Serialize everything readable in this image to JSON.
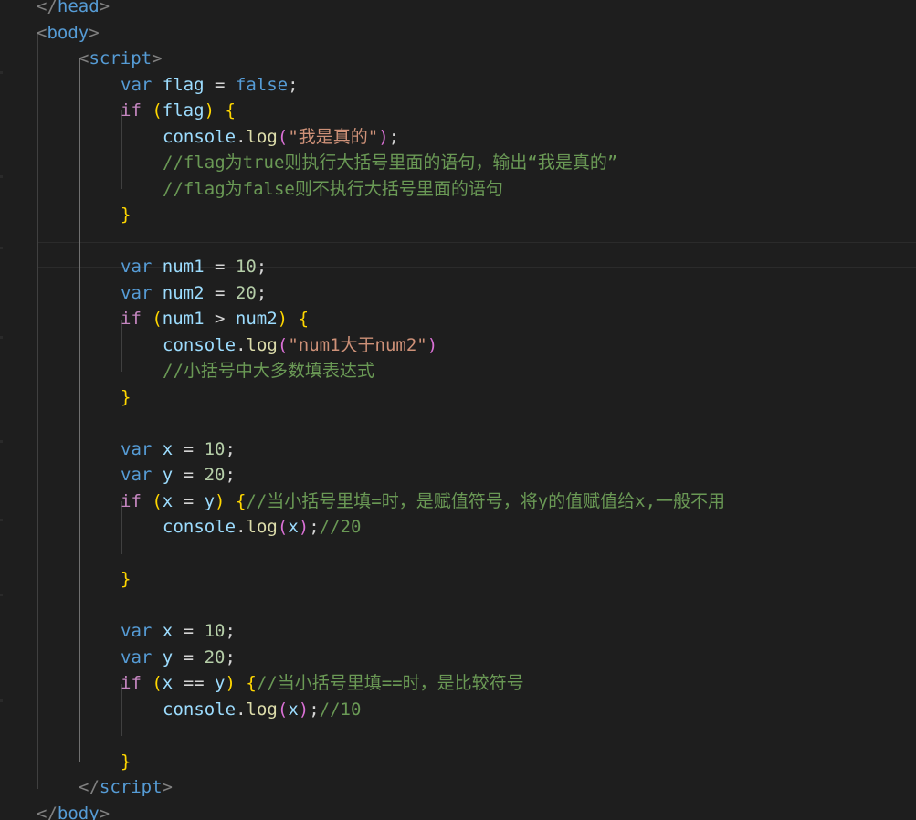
{
  "editor": {
    "theme": {
      "background": "#1e1e1e",
      "tag": "#569cd6",
      "keyword": "#569cd6",
      "control": "#c586c0",
      "identifier": "#9cdcfe",
      "function": "#dcdcaa",
      "number": "#b5cea8",
      "string": "#ce9178",
      "comment": "#6a9955",
      "bracket_level1": "#ffd700",
      "bracket_level2": "#da70d6"
    },
    "lines": [
      {
        "indent": 0,
        "tokens": [
          [
            "punct",
            "</"
          ],
          [
            "tag",
            "head"
          ],
          [
            "punct",
            ">"
          ]
        ]
      },
      {
        "indent": 0,
        "tokens": [
          [
            "punct",
            "<"
          ],
          [
            "tag",
            "body"
          ],
          [
            "punct",
            ">"
          ]
        ]
      },
      {
        "indent": 1,
        "tokens": [
          [
            "punct",
            "<"
          ],
          [
            "tag",
            "script"
          ],
          [
            "punct",
            ">"
          ]
        ]
      },
      {
        "indent": 2,
        "tokens": [
          [
            "kw",
            "var"
          ],
          [
            "op",
            " "
          ],
          [
            "id",
            "flag"
          ],
          [
            "op",
            " = "
          ],
          [
            "kw",
            "false"
          ],
          [
            "op",
            ";"
          ]
        ]
      },
      {
        "indent": 2,
        "tokens": [
          [
            "ctl",
            "if"
          ],
          [
            "op",
            " "
          ],
          [
            "b1",
            "("
          ],
          [
            "id",
            "flag"
          ],
          [
            "b1",
            ")"
          ],
          [
            "op",
            " "
          ],
          [
            "b1",
            "{"
          ]
        ]
      },
      {
        "indent": 3,
        "tokens": [
          [
            "id",
            "console"
          ],
          [
            "op",
            "."
          ],
          [
            "fn",
            "log"
          ],
          [
            "b2",
            "("
          ],
          [
            "str",
            "\"我是真的\""
          ],
          [
            "b2",
            ")"
          ],
          [
            "op",
            ";"
          ]
        ]
      },
      {
        "indent": 3,
        "tokens": [
          [
            "cmt",
            "//flag为true则执行大括号里面的语句，输出“我是真的”"
          ]
        ]
      },
      {
        "indent": 3,
        "tokens": [
          [
            "cmt",
            "//flag为false则不执行大括号里面的语句"
          ]
        ]
      },
      {
        "indent": 2,
        "tokens": [
          [
            "b1",
            "}"
          ]
        ]
      },
      {
        "indent": 2,
        "tokens": []
      },
      {
        "indent": 2,
        "tokens": [
          [
            "kw",
            "var"
          ],
          [
            "op",
            " "
          ],
          [
            "id",
            "num1"
          ],
          [
            "op",
            " = "
          ],
          [
            "num",
            "10"
          ],
          [
            "op",
            ";"
          ]
        ]
      },
      {
        "indent": 2,
        "tokens": [
          [
            "kw",
            "var"
          ],
          [
            "op",
            " "
          ],
          [
            "id",
            "num2"
          ],
          [
            "op",
            " = "
          ],
          [
            "num",
            "20"
          ],
          [
            "op",
            ";"
          ]
        ]
      },
      {
        "indent": 2,
        "tokens": [
          [
            "ctl",
            "if"
          ],
          [
            "op",
            " "
          ],
          [
            "b1",
            "("
          ],
          [
            "id",
            "num1"
          ],
          [
            "op",
            " > "
          ],
          [
            "id",
            "num2"
          ],
          [
            "b1",
            ")"
          ],
          [
            "op",
            " "
          ],
          [
            "b1",
            "{"
          ]
        ]
      },
      {
        "indent": 3,
        "tokens": [
          [
            "id",
            "console"
          ],
          [
            "op",
            "."
          ],
          [
            "fn",
            "log"
          ],
          [
            "b2",
            "("
          ],
          [
            "str",
            "\"num1大于num2\""
          ],
          [
            "b2",
            ")"
          ]
        ]
      },
      {
        "indent": 3,
        "tokens": [
          [
            "cmt",
            "//小括号中大多数填表达式"
          ]
        ]
      },
      {
        "indent": 2,
        "tokens": [
          [
            "b1",
            "}"
          ]
        ]
      },
      {
        "indent": 2,
        "tokens": []
      },
      {
        "indent": 2,
        "tokens": [
          [
            "kw",
            "var"
          ],
          [
            "op",
            " "
          ],
          [
            "id",
            "x"
          ],
          [
            "op",
            " = "
          ],
          [
            "num",
            "10"
          ],
          [
            "op",
            ";"
          ]
        ]
      },
      {
        "indent": 2,
        "tokens": [
          [
            "kw",
            "var"
          ],
          [
            "op",
            " "
          ],
          [
            "id",
            "y"
          ],
          [
            "op",
            " = "
          ],
          [
            "num",
            "20"
          ],
          [
            "op",
            ";"
          ]
        ]
      },
      {
        "indent": 2,
        "tokens": [
          [
            "ctl",
            "if"
          ],
          [
            "op",
            " "
          ],
          [
            "b1",
            "("
          ],
          [
            "id",
            "x"
          ],
          [
            "op",
            " = "
          ],
          [
            "id",
            "y"
          ],
          [
            "b1",
            ")"
          ],
          [
            "op",
            " "
          ],
          [
            "b1",
            "{"
          ],
          [
            "cmt",
            "//当小括号里填=时，是赋值符号，将y的值赋值给x,一般不用"
          ]
        ]
      },
      {
        "indent": 3,
        "tokens": [
          [
            "id",
            "console"
          ],
          [
            "op",
            "."
          ],
          [
            "fn",
            "log"
          ],
          [
            "b2",
            "("
          ],
          [
            "id",
            "x"
          ],
          [
            "b2",
            ")"
          ],
          [
            "op",
            ";"
          ],
          [
            "cmt",
            "//20"
          ]
        ]
      },
      {
        "indent": 3,
        "tokens": []
      },
      {
        "indent": 2,
        "tokens": [
          [
            "b1",
            "}"
          ]
        ]
      },
      {
        "indent": 2,
        "tokens": []
      },
      {
        "indent": 2,
        "tokens": [
          [
            "kw",
            "var"
          ],
          [
            "op",
            " "
          ],
          [
            "id",
            "x"
          ],
          [
            "op",
            " = "
          ],
          [
            "num",
            "10"
          ],
          [
            "op",
            ";"
          ]
        ]
      },
      {
        "indent": 2,
        "tokens": [
          [
            "kw",
            "var"
          ],
          [
            "op",
            " "
          ],
          [
            "id",
            "y"
          ],
          [
            "op",
            " = "
          ],
          [
            "num",
            "20"
          ],
          [
            "op",
            ";"
          ]
        ]
      },
      {
        "indent": 2,
        "tokens": [
          [
            "ctl",
            "if"
          ],
          [
            "op",
            " "
          ],
          [
            "b1",
            "("
          ],
          [
            "id",
            "x"
          ],
          [
            "op",
            " == "
          ],
          [
            "id",
            "y"
          ],
          [
            "b1",
            ")"
          ],
          [
            "op",
            " "
          ],
          [
            "b1",
            "{"
          ],
          [
            "cmt",
            "//当小括号里填==时，是比较符号"
          ]
        ]
      },
      {
        "indent": 3,
        "tokens": [
          [
            "id",
            "console"
          ],
          [
            "op",
            "."
          ],
          [
            "fn",
            "log"
          ],
          [
            "b2",
            "("
          ],
          [
            "id",
            "x"
          ],
          [
            "b2",
            ")"
          ],
          [
            "op",
            ";"
          ],
          [
            "cmt",
            "//10"
          ]
        ]
      },
      {
        "indent": 3,
        "tokens": []
      },
      {
        "indent": 2,
        "tokens": [
          [
            "b1",
            "}"
          ]
        ]
      },
      {
        "indent": 1,
        "tokens": [
          [
            "punct",
            "</"
          ],
          [
            "tag",
            "script"
          ],
          [
            "punct",
            ">"
          ]
        ]
      },
      {
        "indent": 0,
        "tokens": [
          [
            "punct",
            "</"
          ],
          [
            "tag",
            "body"
          ],
          [
            "punct",
            ">"
          ]
        ]
      }
    ]
  }
}
